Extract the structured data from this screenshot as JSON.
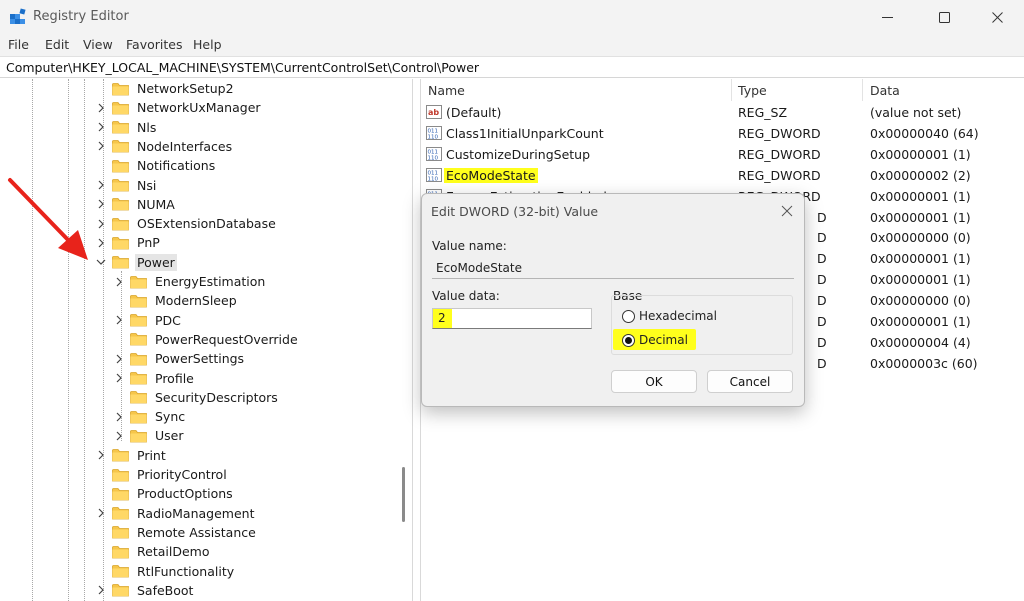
{
  "window": {
    "title": "Registry Editor"
  },
  "menu": [
    "File",
    "Edit",
    "View",
    "Favorites",
    "Help"
  ],
  "address": "Computer\\HKEY_LOCAL_MACHINE\\SYSTEM\\CurrentControlSet\\Control\\Power",
  "tree": {
    "nodes": [
      {
        "label": "NetworkSetup2",
        "level": 1,
        "expand": false
      },
      {
        "label": "NetworkUxManager",
        "level": 1,
        "expand": true
      },
      {
        "label": "Nls",
        "level": 1,
        "expand": true
      },
      {
        "label": "NodeInterfaces",
        "level": 1,
        "expand": true
      },
      {
        "label": "Notifications",
        "level": 1,
        "expand": false
      },
      {
        "label": "Nsi",
        "level": 1,
        "expand": true
      },
      {
        "label": "NUMA",
        "level": 1,
        "expand": true
      },
      {
        "label": "OSExtensionDatabase",
        "level": 1,
        "expand": true
      },
      {
        "label": "PnP",
        "level": 1,
        "expand": true
      },
      {
        "label": "Power",
        "level": 1,
        "expand": "open",
        "selected": true
      },
      {
        "label": "EnergyEstimation",
        "level": 2,
        "expand": true
      },
      {
        "label": "ModernSleep",
        "level": 2,
        "expand": false
      },
      {
        "label": "PDC",
        "level": 2,
        "expand": true
      },
      {
        "label": "PowerRequestOverride",
        "level": 2,
        "expand": false
      },
      {
        "label": "PowerSettings",
        "level": 2,
        "expand": true
      },
      {
        "label": "Profile",
        "level": 2,
        "expand": true
      },
      {
        "label": "SecurityDescriptors",
        "level": 2,
        "expand": false
      },
      {
        "label": "Sync",
        "level": 2,
        "expand": true
      },
      {
        "label": "User",
        "level": 2,
        "expand": true
      },
      {
        "label": "Print",
        "level": 1,
        "expand": true
      },
      {
        "label": "PriorityControl",
        "level": 1,
        "expand": false
      },
      {
        "label": "ProductOptions",
        "level": 1,
        "expand": false
      },
      {
        "label": "RadioManagement",
        "level": 1,
        "expand": true
      },
      {
        "label": "Remote Assistance",
        "level": 1,
        "expand": false
      },
      {
        "label": "RetailDemo",
        "level": 1,
        "expand": false
      },
      {
        "label": "RtlFunctionality",
        "level": 1,
        "expand": false
      },
      {
        "label": "SafeBoot",
        "level": 1,
        "expand": true
      }
    ]
  },
  "list": {
    "columns": {
      "name": "Name",
      "type": "Type",
      "data": "Data"
    },
    "rows": [
      {
        "name": "(Default)",
        "type": "REG_SZ",
        "data": "(value not set)",
        "icon": "string-value-icon"
      },
      {
        "name": "Class1InitialUnparkCount",
        "type": "REG_DWORD",
        "data": "0x00000040 (64)",
        "icon": "dword-value-icon"
      },
      {
        "name": "CustomizeDuringSetup",
        "type": "REG_DWORD",
        "data": "0x00000001 (1)",
        "icon": "dword-value-icon"
      },
      {
        "name": "EcoModeState",
        "type": "REG_DWORD",
        "data": "0x00000002 (2)",
        "icon": "dword-value-icon",
        "highlight": true
      },
      {
        "name": "EnergyEstimationEnabled",
        "type": "REG_DWORD",
        "data": "0x00000001 (1)",
        "icon": "dword-value-icon"
      },
      {
        "name": "",
        "type": "D",
        "data": "0x00000001 (1)",
        "icon": "dword-value-icon"
      },
      {
        "name": "",
        "type": "D",
        "data": "0x00000000 (0)",
        "icon": "dword-value-icon"
      },
      {
        "name": "",
        "type": "D",
        "data": "0x00000001 (1)",
        "icon": "dword-value-icon"
      },
      {
        "name": "",
        "type": "D",
        "data": "0x00000001 (1)",
        "icon": "dword-value-icon"
      },
      {
        "name": "",
        "type": "D",
        "data": "0x00000000 (0)",
        "icon": "dword-value-icon"
      },
      {
        "name": "",
        "type": "D",
        "data": "0x00000001 (1)",
        "icon": "dword-value-icon"
      },
      {
        "name": "",
        "type": "D",
        "data": "0x00000004 (4)",
        "icon": "dword-value-icon"
      },
      {
        "name": "",
        "type": "D",
        "data": "0x0000003c (60)",
        "icon": "dword-value-icon"
      }
    ]
  },
  "dialog": {
    "title": "Edit DWORD (32-bit) Value",
    "value_name_label": "Value name:",
    "value_name": "EcoModeState",
    "value_data_label": "Value data:",
    "value_data": "2",
    "base_label": "Base",
    "hex_label": "Hexadecimal",
    "dec_label": "Decimal",
    "selected_base": "Decimal",
    "ok_label": "OK",
    "cancel_label": "Cancel"
  },
  "colors": {
    "highlight": "#ffff1c",
    "annotation_arrow": "#e8231b",
    "folder": "#f6c64a"
  }
}
